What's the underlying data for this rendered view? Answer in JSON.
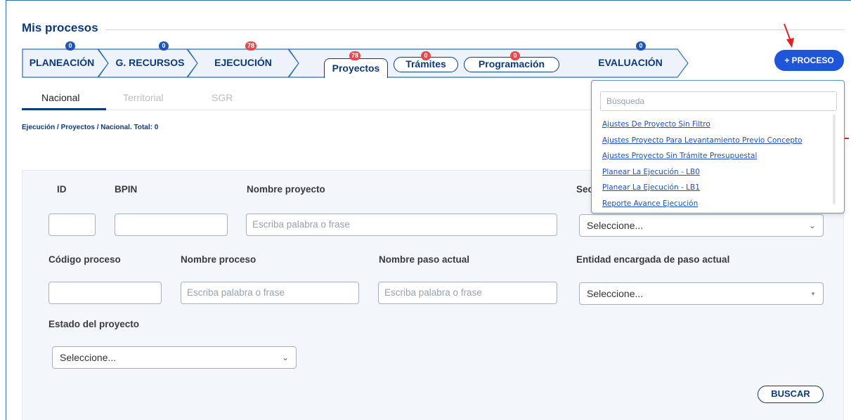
{
  "page": {
    "title": "Mis procesos",
    "breadcrumb": "Ejecución / Proyectos / Nacional. Total: 0"
  },
  "stages": [
    {
      "label": "PLANEACIÓN",
      "badge": "0",
      "badge_color": "#1f55b8"
    },
    {
      "label": "G. RECURSOS",
      "badge": "0",
      "badge_color": "#1f55b8"
    },
    {
      "label": "EJECUCIÓN",
      "badge": "78",
      "badge_color": "#e5484d"
    },
    {
      "label": "EVALUACIÓN",
      "badge": "0",
      "badge_color": "#1f55b8"
    }
  ],
  "subtabs": [
    {
      "label": "Proyectos",
      "badge": "78",
      "active": true
    },
    {
      "label": "Trámites",
      "badge": "0",
      "active": false
    },
    {
      "label": "Programación",
      "badge": "0",
      "active": false
    }
  ],
  "new_process_button": "+ PROCESO",
  "region_tabs": [
    {
      "label": "Nacional",
      "active": true
    },
    {
      "label": "Territorial",
      "active": false
    },
    {
      "label": "SGR",
      "active": false
    }
  ],
  "filters": {
    "id_label": "ID",
    "bpin_label": "BPIN",
    "nombre_proyecto_label": "Nombre proyecto",
    "nombre_proyecto_placeholder": "Escriba palabra o frase",
    "sector_label": "Sec",
    "sector_value": "Seleccione...",
    "codigo_proceso_label": "Código proceso",
    "nombre_proceso_label": "Nombre proceso",
    "nombre_proceso_placeholder": "Escriba palabra o frase",
    "nombre_paso_label": "Nombre paso actual",
    "nombre_paso_placeholder": "Escriba palabra o frase",
    "entidad_label": "Entidad encargada de paso actual",
    "entidad_value": "Seleccione...",
    "estado_label": "Estado del proyecto",
    "estado_value": "Seleccione...",
    "search_button": "BUSCAR"
  },
  "popup": {
    "search_placeholder": "Búsqueda",
    "items": [
      "Ajustes De Proyecto Sin Filtro",
      "Ajustes Proyecto Para Levantamiento Previo Concepto",
      "Ajustes Proyecto Sin Trámite Presupuestal",
      "Planear La Ejecución - LB0",
      "Planear La Ejecución - LB1",
      "Reporte Avance Ejecución"
    ]
  },
  "colors": {
    "primary_navy": "#0b3a7a",
    "button_blue": "#1f55d8",
    "badge_red": "#e5484d",
    "annotation_red": "#e02020"
  }
}
